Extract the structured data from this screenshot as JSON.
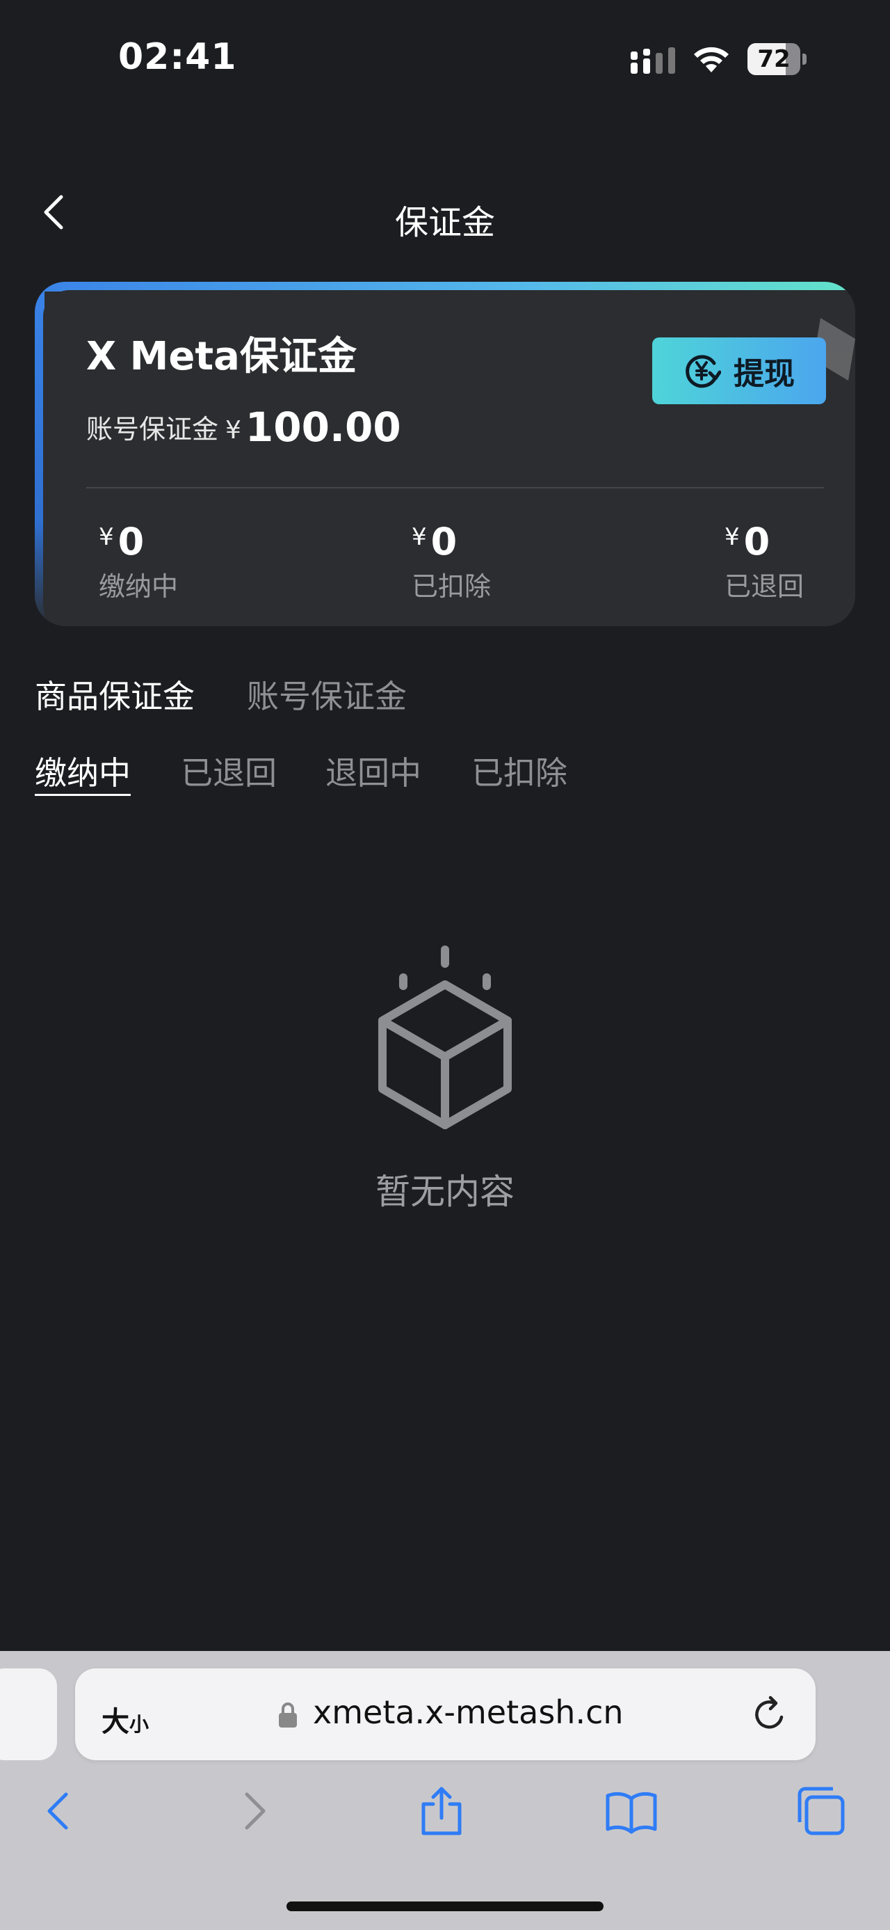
{
  "status_bar": {
    "time": "02:41",
    "battery": "72",
    "battery_fraction": 0.72
  },
  "nav": {
    "title": "保证金",
    "back_icon": "chevron-left-icon"
  },
  "summary_card": {
    "title": "X Meta保证金",
    "deposit_label": "账号保证金",
    "currency": "¥",
    "deposit_amount": "100.00",
    "withdraw_label": "提现",
    "withdraw_icon": "yen-exchange-icon",
    "stats": [
      {
        "value": "0",
        "label": "缴纳中"
      },
      {
        "value": "0",
        "label": "已扣除"
      },
      {
        "value": "0",
        "label": "已退回"
      }
    ],
    "accent_colors": [
      "#3a83e8",
      "#63e3c9"
    ]
  },
  "type_tabs": [
    {
      "label": "商品保证金",
      "active": true
    },
    {
      "label": "账号保证金",
      "active": false
    }
  ],
  "status_tabs": [
    {
      "label": "缴纳中",
      "active": true
    },
    {
      "label": "已退回",
      "active": false
    },
    {
      "label": "退回中",
      "active": false
    },
    {
      "label": "已扣除",
      "active": false
    }
  ],
  "empty_state": {
    "icon": "empty-box-icon",
    "text": "暂无内容"
  },
  "browser": {
    "text_size_label": "大",
    "text_size_label_small": "小",
    "url": "xmeta.x-metash.cn",
    "toolbar_icons": [
      "back-icon",
      "forward-icon",
      "share-icon",
      "bookmarks-icon",
      "tabs-icon"
    ]
  }
}
